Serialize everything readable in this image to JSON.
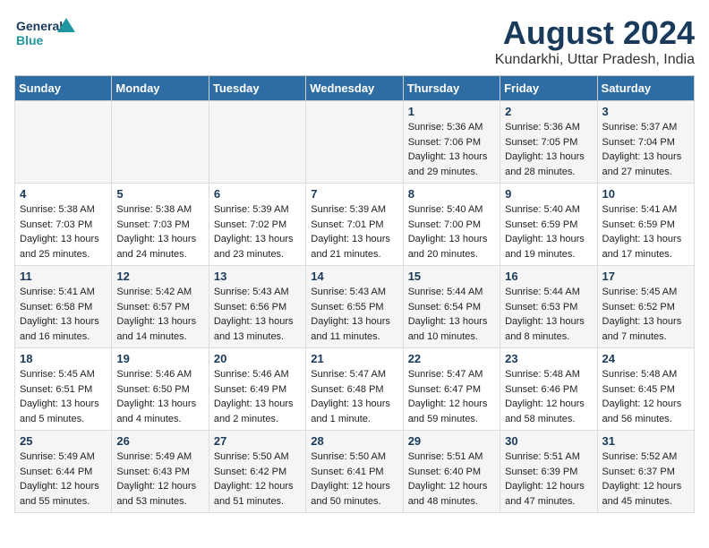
{
  "header": {
    "logo_line1": "General",
    "logo_line2": "Blue",
    "main_title": "August 2024",
    "subtitle": "Kundarkhi, Uttar Pradesh, India"
  },
  "days_of_week": [
    "Sunday",
    "Monday",
    "Tuesday",
    "Wednesday",
    "Thursday",
    "Friday",
    "Saturday"
  ],
  "weeks": [
    [
      {
        "day": "",
        "info": ""
      },
      {
        "day": "",
        "info": ""
      },
      {
        "day": "",
        "info": ""
      },
      {
        "day": "",
        "info": ""
      },
      {
        "day": "1",
        "info": "Sunrise: 5:36 AM\nSunset: 7:06 PM\nDaylight: 13 hours\nand 29 minutes."
      },
      {
        "day": "2",
        "info": "Sunrise: 5:36 AM\nSunset: 7:05 PM\nDaylight: 13 hours\nand 28 minutes."
      },
      {
        "day": "3",
        "info": "Sunrise: 5:37 AM\nSunset: 7:04 PM\nDaylight: 13 hours\nand 27 minutes."
      }
    ],
    [
      {
        "day": "4",
        "info": "Sunrise: 5:38 AM\nSunset: 7:03 PM\nDaylight: 13 hours\nand 25 minutes."
      },
      {
        "day": "5",
        "info": "Sunrise: 5:38 AM\nSunset: 7:03 PM\nDaylight: 13 hours\nand 24 minutes."
      },
      {
        "day": "6",
        "info": "Sunrise: 5:39 AM\nSunset: 7:02 PM\nDaylight: 13 hours\nand 23 minutes."
      },
      {
        "day": "7",
        "info": "Sunrise: 5:39 AM\nSunset: 7:01 PM\nDaylight: 13 hours\nand 21 minutes."
      },
      {
        "day": "8",
        "info": "Sunrise: 5:40 AM\nSunset: 7:00 PM\nDaylight: 13 hours\nand 20 minutes."
      },
      {
        "day": "9",
        "info": "Sunrise: 5:40 AM\nSunset: 6:59 PM\nDaylight: 13 hours\nand 19 minutes."
      },
      {
        "day": "10",
        "info": "Sunrise: 5:41 AM\nSunset: 6:59 PM\nDaylight: 13 hours\nand 17 minutes."
      }
    ],
    [
      {
        "day": "11",
        "info": "Sunrise: 5:41 AM\nSunset: 6:58 PM\nDaylight: 13 hours\nand 16 minutes."
      },
      {
        "day": "12",
        "info": "Sunrise: 5:42 AM\nSunset: 6:57 PM\nDaylight: 13 hours\nand 14 minutes."
      },
      {
        "day": "13",
        "info": "Sunrise: 5:43 AM\nSunset: 6:56 PM\nDaylight: 13 hours\nand 13 minutes."
      },
      {
        "day": "14",
        "info": "Sunrise: 5:43 AM\nSunset: 6:55 PM\nDaylight: 13 hours\nand 11 minutes."
      },
      {
        "day": "15",
        "info": "Sunrise: 5:44 AM\nSunset: 6:54 PM\nDaylight: 13 hours\nand 10 minutes."
      },
      {
        "day": "16",
        "info": "Sunrise: 5:44 AM\nSunset: 6:53 PM\nDaylight: 13 hours\nand 8 minutes."
      },
      {
        "day": "17",
        "info": "Sunrise: 5:45 AM\nSunset: 6:52 PM\nDaylight: 13 hours\nand 7 minutes."
      }
    ],
    [
      {
        "day": "18",
        "info": "Sunrise: 5:45 AM\nSunset: 6:51 PM\nDaylight: 13 hours\nand 5 minutes."
      },
      {
        "day": "19",
        "info": "Sunrise: 5:46 AM\nSunset: 6:50 PM\nDaylight: 13 hours\nand 4 minutes."
      },
      {
        "day": "20",
        "info": "Sunrise: 5:46 AM\nSunset: 6:49 PM\nDaylight: 13 hours\nand 2 minutes."
      },
      {
        "day": "21",
        "info": "Sunrise: 5:47 AM\nSunset: 6:48 PM\nDaylight: 13 hours\nand 1 minute."
      },
      {
        "day": "22",
        "info": "Sunrise: 5:47 AM\nSunset: 6:47 PM\nDaylight: 12 hours\nand 59 minutes."
      },
      {
        "day": "23",
        "info": "Sunrise: 5:48 AM\nSunset: 6:46 PM\nDaylight: 12 hours\nand 58 minutes."
      },
      {
        "day": "24",
        "info": "Sunrise: 5:48 AM\nSunset: 6:45 PM\nDaylight: 12 hours\nand 56 minutes."
      }
    ],
    [
      {
        "day": "25",
        "info": "Sunrise: 5:49 AM\nSunset: 6:44 PM\nDaylight: 12 hours\nand 55 minutes."
      },
      {
        "day": "26",
        "info": "Sunrise: 5:49 AM\nSunset: 6:43 PM\nDaylight: 12 hours\nand 53 minutes."
      },
      {
        "day": "27",
        "info": "Sunrise: 5:50 AM\nSunset: 6:42 PM\nDaylight: 12 hours\nand 51 minutes."
      },
      {
        "day": "28",
        "info": "Sunrise: 5:50 AM\nSunset: 6:41 PM\nDaylight: 12 hours\nand 50 minutes."
      },
      {
        "day": "29",
        "info": "Sunrise: 5:51 AM\nSunset: 6:40 PM\nDaylight: 12 hours\nand 48 minutes."
      },
      {
        "day": "30",
        "info": "Sunrise: 5:51 AM\nSunset: 6:39 PM\nDaylight: 12 hours\nand 47 minutes."
      },
      {
        "day": "31",
        "info": "Sunrise: 5:52 AM\nSunset: 6:37 PM\nDaylight: 12 hours\nand 45 minutes."
      }
    ]
  ]
}
